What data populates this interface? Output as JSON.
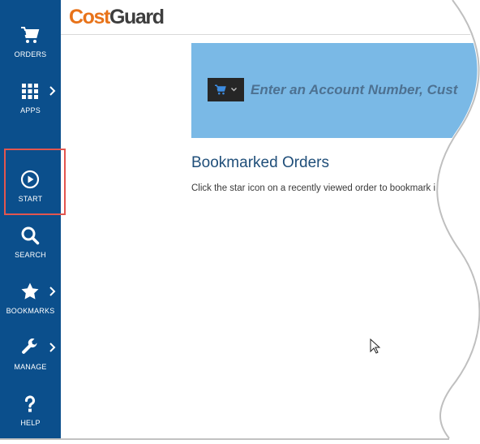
{
  "app": {
    "logo_part1": "Cost",
    "logo_part2": "Guard"
  },
  "sidebar": {
    "items": [
      {
        "label": "ORDERS",
        "icon": "cart-icon"
      },
      {
        "label": "APPS",
        "icon": "grid-icon"
      },
      {
        "label": "START",
        "icon": "play-circle-icon"
      },
      {
        "label": "SEARCH",
        "icon": "search-icon"
      },
      {
        "label": "BOOKMARKS",
        "icon": "star-icon"
      },
      {
        "label": "MANAGE",
        "icon": "wrench-icon"
      },
      {
        "label": "HELP",
        "icon": "question-icon"
      }
    ]
  },
  "search": {
    "placeholder": "Enter an Account Number, Cust",
    "type_icon": "cart-icon"
  },
  "bookmarks": {
    "title": "Bookmarked Orders",
    "description": "Click the star icon on a recently viewed order to bookmark i"
  },
  "colors": {
    "sidebar": "#0b4f8c",
    "banner": "#7ab9e6",
    "logo_accent": "#e8731a",
    "highlight": "#e2564f"
  }
}
